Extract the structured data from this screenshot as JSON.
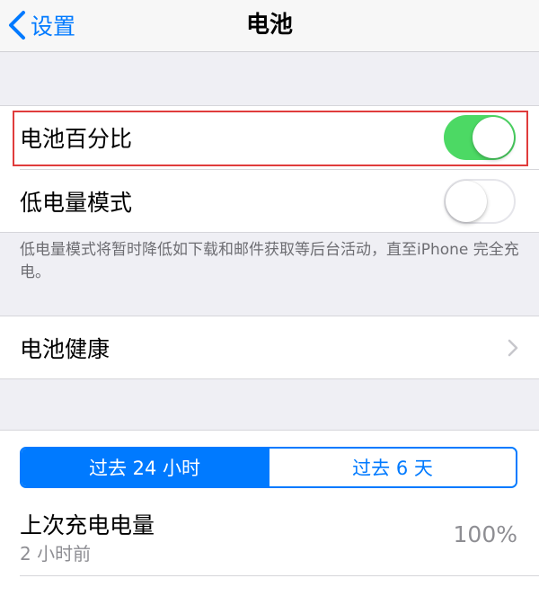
{
  "navbar": {
    "back_label": "设置",
    "title": "电池"
  },
  "settings": {
    "battery_percentage": {
      "label": "电池百分比",
      "enabled": true
    },
    "low_power_mode": {
      "label": "低电量模式",
      "enabled": false
    },
    "low_power_footnote": "低电量模式将暂时降低如下载和邮件获取等后台活动，直至iPhone 完全充电。",
    "battery_health": {
      "label": "电池健康"
    }
  },
  "usage": {
    "segments": [
      {
        "label": "过去 24 小时",
        "selected": true
      },
      {
        "label": "过去 6 天",
        "selected": false
      }
    ],
    "last_charge": {
      "title": "上次充电电量",
      "time": "2 小时前",
      "value": "100%"
    }
  },
  "colors": {
    "accent": "#007aff",
    "toggle_on": "#4cd964",
    "highlight_box": "#e03c3c"
  },
  "icons": {
    "back": "chevron-left-icon",
    "disclosure": "chevron-right-icon"
  }
}
